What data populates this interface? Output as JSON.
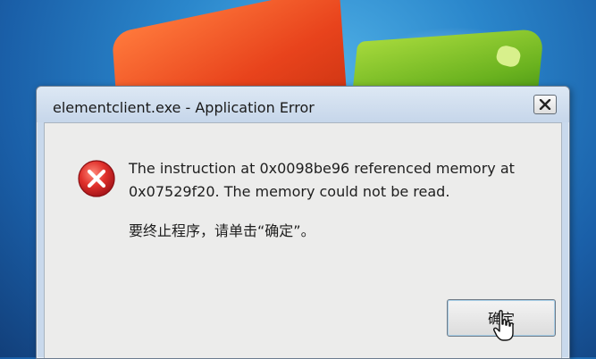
{
  "dialog": {
    "title": "elementclient.exe - Application Error",
    "close_icon": "close-icon",
    "error_icon": "error-icon",
    "message_line1": "The instruction at 0x0098be96 referenced memory at",
    "message_line2": "0x07529f20. The memory could not be read.",
    "message_cn": "要终止程序，请单击“确定”。",
    "ok_label": "确定"
  },
  "colors": {
    "error_red": "#d8262a",
    "title_bar": "#c6d6ea",
    "client_bg": "#ececeb"
  },
  "cursor_icon": "hand-pointer-icon"
}
